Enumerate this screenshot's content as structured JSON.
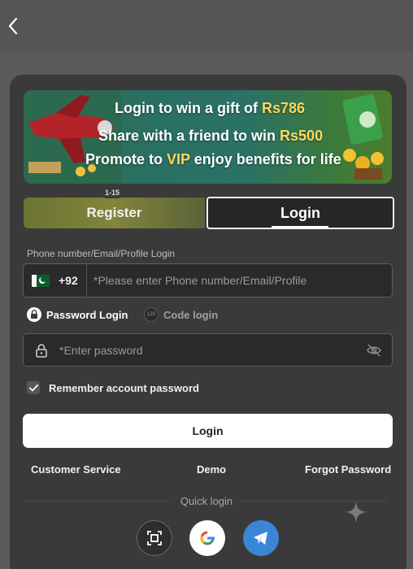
{
  "banner": {
    "line1_pre": "Login to win a gift of ",
    "line1_hl": "Rs786",
    "line2_pre": "Share with a friend to win ",
    "line2_hl": "Rs500",
    "line3_pre": "Promote to ",
    "line3_hl": "VIP",
    "line3_post": " enjoy benefits for life",
    "age_badge": "1-15"
  },
  "tabs": {
    "register": "Register",
    "login": "Login"
  },
  "form": {
    "phone_label": "Phone number/Email/Profile Login",
    "country_code": "+92",
    "phone_placeholder": "*Please enter Phone number/Email/Profile",
    "method_password": "Password Login",
    "method_code": "Code login",
    "code_badge": "123",
    "password_placeholder": "*Enter password",
    "remember_label": "Remember account password",
    "remember_checked": true,
    "login_button": "Login"
  },
  "links": {
    "customer_service": "Customer Service",
    "demo": "Demo",
    "forgot_password": "Forgot Password"
  },
  "quick_login": {
    "label": "Quick login",
    "providers": [
      "scan-icon",
      "google-icon",
      "telegram-icon"
    ]
  },
  "colors": {
    "background": "#5a5a5a",
    "card": "#3a3a3a",
    "highlight": "#ffd75a",
    "telegram": "#3a86d6"
  }
}
